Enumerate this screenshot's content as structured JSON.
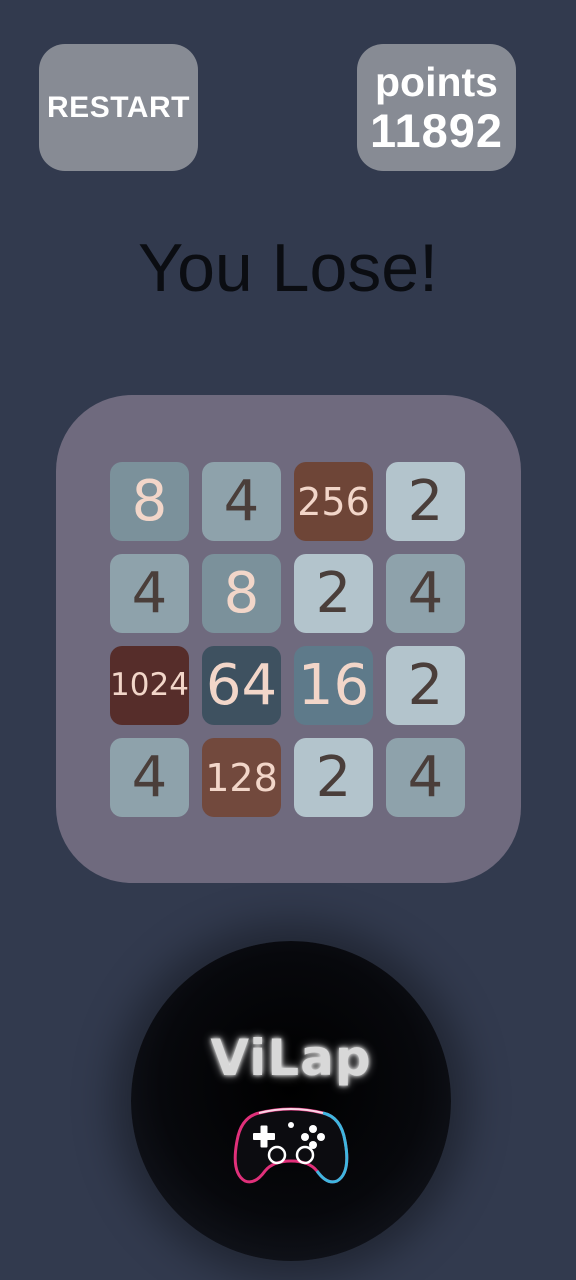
{
  "header": {
    "restart_label": "RESTART",
    "score_label": "points",
    "score_value": "11892"
  },
  "status_message": "You Lose!",
  "board": {
    "rows": [
      [
        "8",
        "4",
        "256",
        "2"
      ],
      [
        "4",
        "8",
        "2",
        "4"
      ],
      [
        "1024",
        "64",
        "16",
        "2"
      ],
      [
        "4",
        "128",
        "2",
        "4"
      ]
    ]
  },
  "tile_styles": {
    "2": {
      "bg": "#b3c4cc",
      "fg": "#4a3e3a"
    },
    "4": {
      "bg": "#8ea2ab",
      "fg": "#4a3e3a"
    },
    "8": {
      "bg": "#7b919b",
      "fg": "#f2d6c9"
    },
    "16": {
      "bg": "#5e7a8a",
      "fg": "#f2d6c9"
    },
    "64": {
      "bg": "#3e5160",
      "fg": "#f2d6c9"
    },
    "128": {
      "bg": "#72493d",
      "fg": "#f2d6c9"
    },
    "256": {
      "bg": "#6e4537",
      "fg": "#f2d6c9"
    },
    "1024": {
      "bg": "#562d2a",
      "fg": "#f2d6c9"
    }
  },
  "logo": {
    "text": "ViLap",
    "icon": "gamepad-icon"
  },
  "colors": {
    "background": "#323a4e",
    "button": "#878b94",
    "board": "#6f6a7e"
  }
}
